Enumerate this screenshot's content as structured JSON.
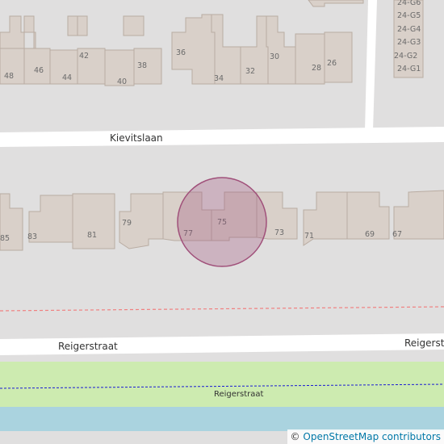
{
  "map": {
    "streets": {
      "kievitslaan": "Kievitslaan",
      "reigerstraat_left": "Reigerstraat",
      "reigerstraat_right": "Reigerstraat",
      "reigerstraat_path": "Reigerstraat"
    },
    "house_numbers_north": [
      "48",
      "46",
      "44",
      "42",
      "40",
      "38",
      "36",
      "34",
      "32",
      "30",
      "28",
      "26"
    ],
    "house_numbers_east": [
      "24-G6",
      "24-G5",
      "24-G4",
      "24-G3",
      "24-G2",
      "24-G1"
    ],
    "house_numbers_south": [
      "85",
      "83",
      "81",
      "79",
      "77",
      "75",
      "73",
      "71",
      "69",
      "67"
    ],
    "marker": {
      "label": "75",
      "color": "#a0507a"
    },
    "colors": {
      "road": "#ffffff",
      "background": "#e0dfdf",
      "building": "#d9d0c9",
      "grass": "#cdebb0",
      "water": "#aad3df",
      "boundary": "#f08080",
      "path": "#1a1ad4"
    }
  },
  "attribution": {
    "symbol": "©",
    "link_text": "OpenStreetMap contributors"
  }
}
